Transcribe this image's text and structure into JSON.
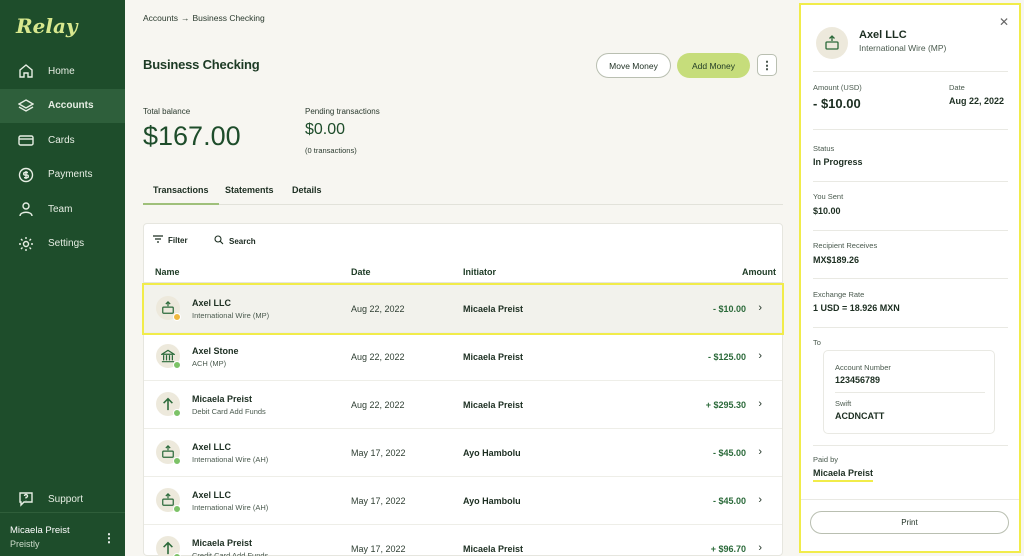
{
  "app": {
    "logo": "Relay"
  },
  "sidebar": {
    "items": [
      {
        "label": "Home",
        "icon": "home-icon"
      },
      {
        "label": "Accounts",
        "icon": "layers-icon"
      },
      {
        "label": "Cards",
        "icon": "card-icon"
      },
      {
        "label": "Payments",
        "icon": "dollar-icon"
      },
      {
        "label": "Team",
        "icon": "person-icon"
      },
      {
        "label": "Settings",
        "icon": "gear-icon"
      }
    ],
    "active": "Accounts",
    "support": "Support",
    "user": {
      "name": "Micaela Preist",
      "sub": "Preistly"
    }
  },
  "header": {
    "breadcrumb": [
      "Accounts",
      "→",
      "Business Checking"
    ],
    "title": "Business Checking",
    "move_money": "Move Money",
    "add_money": "Add Money"
  },
  "balances": {
    "total_label": "Total balance",
    "total_value": "$167.00",
    "pending_label": "Pending transactions",
    "pending_value": "$0.00",
    "pending_sub": "(0 transactions)"
  },
  "tabs": [
    "Transactions",
    "Statements",
    "Details"
  ],
  "table": {
    "filter": "Filter",
    "search": "Search",
    "columns": [
      "Name",
      "Date",
      "Initiator",
      "Amount"
    ],
    "rows": [
      {
        "name": "Axel LLC",
        "sub": "International Wire (MP)",
        "date": "Aug 22, 2022",
        "initiator": "Micaela Preist",
        "amount": "- $10.00",
        "icon": "wire-icon",
        "status": "in-progress"
      },
      {
        "name": "Axel Stone",
        "sub": "ACH (MP)",
        "date": "Aug 22, 2022",
        "initiator": "Micaela Preist",
        "amount": "- $125.00",
        "icon": "bank-icon",
        "status": "completed"
      },
      {
        "name": "Micaela Preist",
        "sub": "Debit Card Add Funds",
        "date": "Aug 22, 2022",
        "initiator": "Micaela Preist",
        "amount": "+ $295.30",
        "icon": "arrow-up-icon",
        "status": "completed"
      },
      {
        "name": "Axel LLC",
        "sub": "International Wire (AH)",
        "date": "May 17, 2022",
        "initiator": "Ayo Hambolu",
        "amount": "- $45.00",
        "icon": "wire-icon",
        "status": "completed"
      },
      {
        "name": "Axel LLC",
        "sub": "International Wire (AH)",
        "date": "May 17, 2022",
        "initiator": "Ayo Hambolu",
        "amount": "- $45.00",
        "icon": "wire-icon",
        "status": "completed"
      },
      {
        "name": "Micaela Preist",
        "sub": "Credit Card Add Funds",
        "date": "May 17, 2022",
        "initiator": "Micaela Preist",
        "amount": "+ $96.70",
        "icon": "arrow-up-icon",
        "status": "completed"
      }
    ]
  },
  "detail": {
    "title": "Axel LLC",
    "subtitle": "International Wire (MP)",
    "amount_label": "Amount (USD)",
    "amount": "- $10.00",
    "date_label": "Date",
    "date": "Aug 22, 2022",
    "status_label": "Status",
    "status": "In Progress",
    "sent_label": "You Sent",
    "sent": "$10.00",
    "receives_label": "Recipient Receives",
    "receives": "MX$189.26",
    "rate_label": "Exchange Rate",
    "rate": "1 USD = 18.926 MXN",
    "to_label": "To",
    "account_label": "Account Number",
    "account": "123456789",
    "swift_label": "Swift",
    "swift": "ACDNCATT",
    "paid_label": "Paid by",
    "paid": "Micaela Preist",
    "print": "Print"
  },
  "colors": {
    "sidebar": "#1e4d2b",
    "accent": "#c6dd7b",
    "highlight": "#f1ec4a",
    "dot_in_progress": "#f0b840",
    "dot_completed": "#7cc267"
  }
}
